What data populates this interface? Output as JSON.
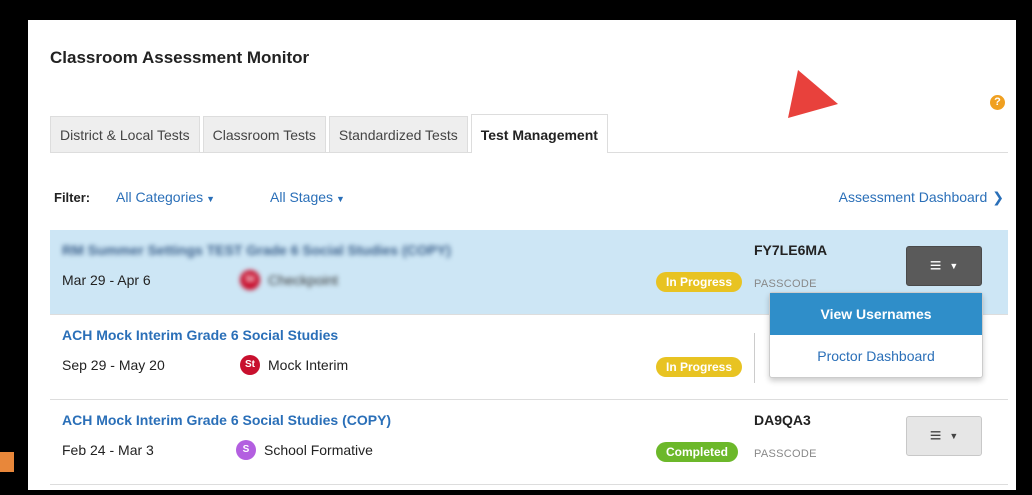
{
  "app": {
    "title": "Classroom Assessment Monitor",
    "help_icon": "?"
  },
  "tabs": [
    {
      "label": "District & Local Tests",
      "active": false
    },
    {
      "label": "Classroom Tests",
      "active": false
    },
    {
      "label": "Standardized Tests",
      "active": false
    },
    {
      "label": "Test Management",
      "active": true
    }
  ],
  "filter": {
    "label": "Filter:",
    "categories": "All Categories",
    "stages": "All Stages"
  },
  "dashboard_link": {
    "label": "Assessment Dashboard",
    "chevron": "❯"
  },
  "tests": [
    {
      "title": "RM Summer Settings TEST Grade 6 Social Studies (COPY)",
      "dates": "Mar 29 - Apr 6",
      "category_badge": "St",
      "category": "Checkpoint",
      "status": "In Progress",
      "passcode": "FY7LE6MA",
      "passcode_label": "PASSCODE",
      "highlighted": true
    },
    {
      "title": "ACH Mock Interim Grade 6 Social Studies",
      "dates": "Sep 29 - May 20",
      "category_badge": "St",
      "category": "Mock Interim",
      "status": "In Progress"
    },
    {
      "title": "ACH Mock Interim Grade 6 Social Studies (COPY)",
      "dates": "Feb 24 - Mar 3",
      "category_badge": "S",
      "category": "School Formative",
      "status": "Completed",
      "passcode": "DA9QA3",
      "passcode_label": "PASSCODE"
    }
  ],
  "dropdown_menu": {
    "items": [
      {
        "label": "View Usernames",
        "active": true
      },
      {
        "label": "Proctor Dashboard",
        "active": false
      }
    ]
  },
  "icons": {
    "menu": "hamburger-icon",
    "caret": "caret-down-icon",
    "help": "help-icon",
    "annotation": "red-arrow-icon"
  },
  "colors": {
    "accent_blue": "#2a6fb8",
    "highlight_row": "#cde6f5",
    "status_in_progress": "#e8c322",
    "status_completed": "#6cb82a",
    "badge_st": "#c8102e",
    "badge_s": "#b35fe0",
    "menu_active": "#2f8ec9",
    "help": "#f0a020",
    "annotation_arrow": "#e8413c"
  }
}
